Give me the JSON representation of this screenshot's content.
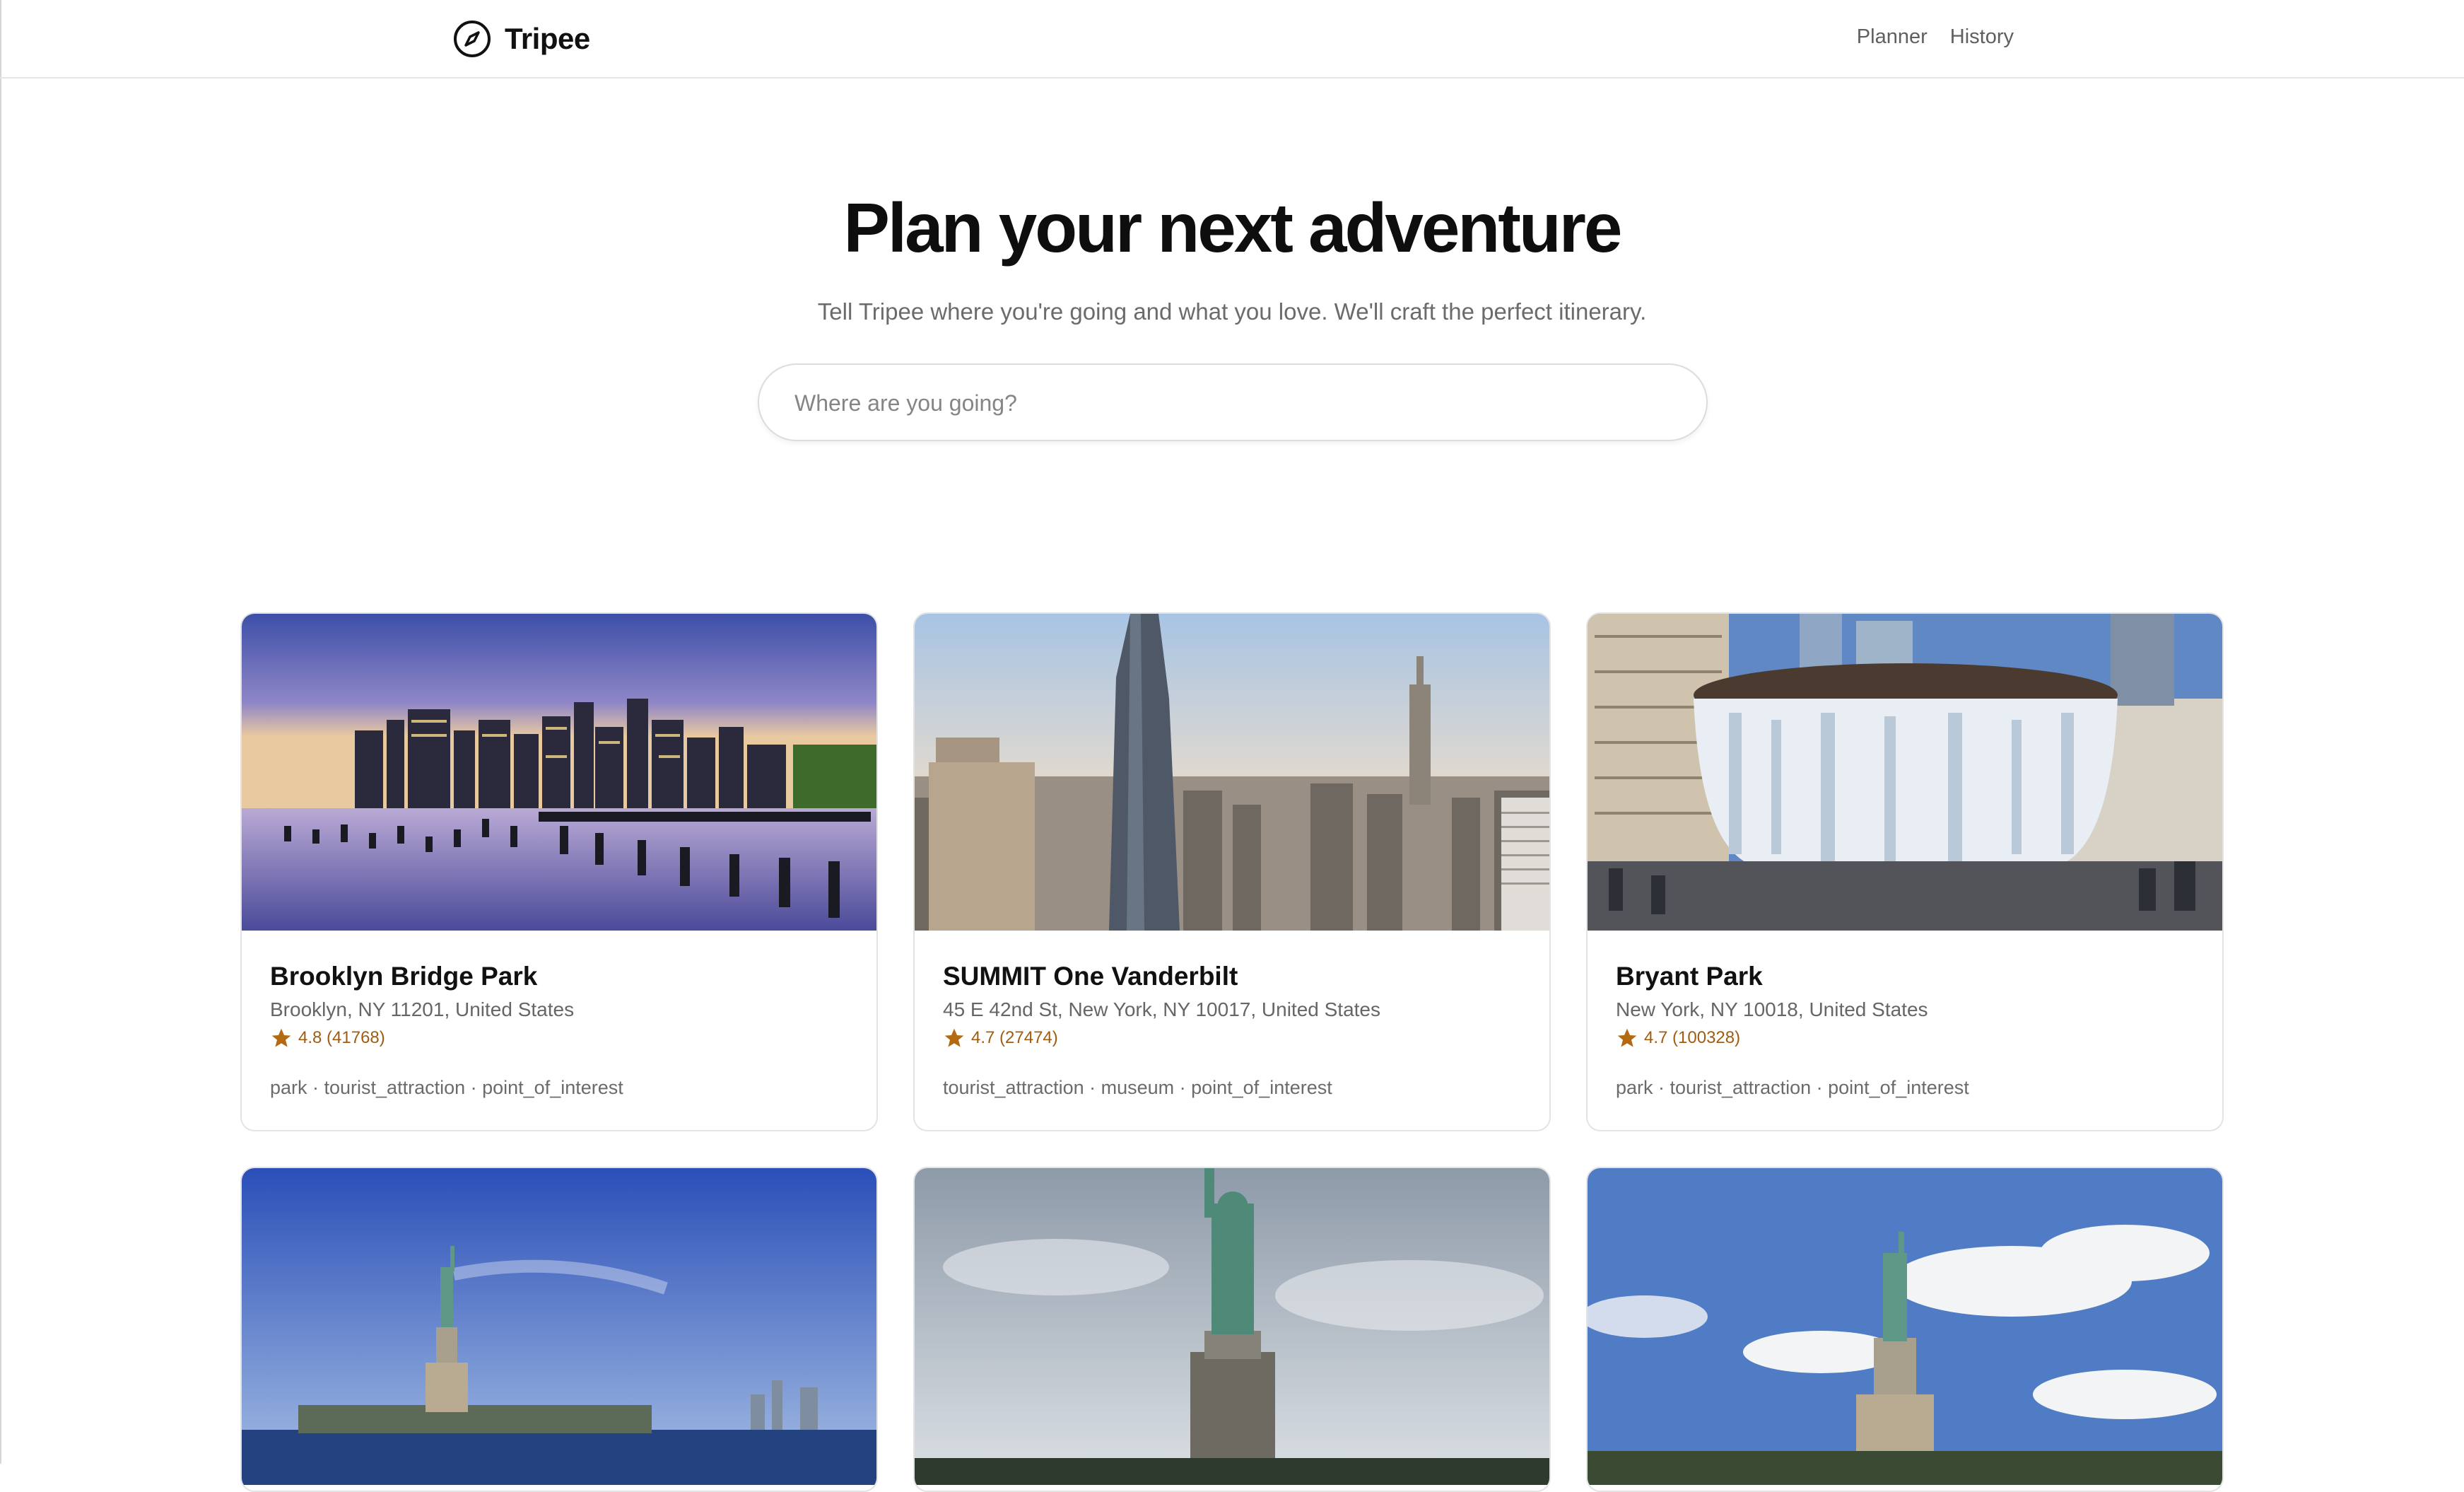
{
  "app": {
    "name": "Tripee"
  },
  "nav": {
    "planner": "Planner",
    "history": "History"
  },
  "hero": {
    "title": "Plan your next adventure",
    "subtitle": "Tell Tripee where you're going and what you love. We'll craft the perfect itinerary."
  },
  "search": {
    "placeholder": "Where are you going?",
    "value": ""
  },
  "places": [
    {
      "name": "Brooklyn Bridge Park",
      "address": "Brooklyn, NY 11201, United States",
      "rating": "4.8 (41768)",
      "tags": "park · tourist_attraction · point_of_interest"
    },
    {
      "name": "SUMMIT One Vanderbilt",
      "address": "45 E 42nd St, New York, NY 10017, United States",
      "rating": "4.7 (27474)",
      "tags": "tourist_attraction · museum · point_of_interest"
    },
    {
      "name": "Bryant Park",
      "address": "New York, NY 10018, United States",
      "rating": "4.7 (100328)",
      "tags": "park · tourist_attraction · point_of_interest"
    },
    {
      "name": "",
      "address": "",
      "rating": "",
      "tags": ""
    },
    {
      "name": "",
      "address": "",
      "rating": "",
      "tags": ""
    },
    {
      "name": "",
      "address": "",
      "rating": "",
      "tags": ""
    }
  ],
  "colors": {
    "rating": "#a15c12",
    "star": "#b36a10",
    "muted_text": "#6b6b6b"
  },
  "icons": {
    "logo": "compass-icon",
    "rating": "star-icon"
  }
}
